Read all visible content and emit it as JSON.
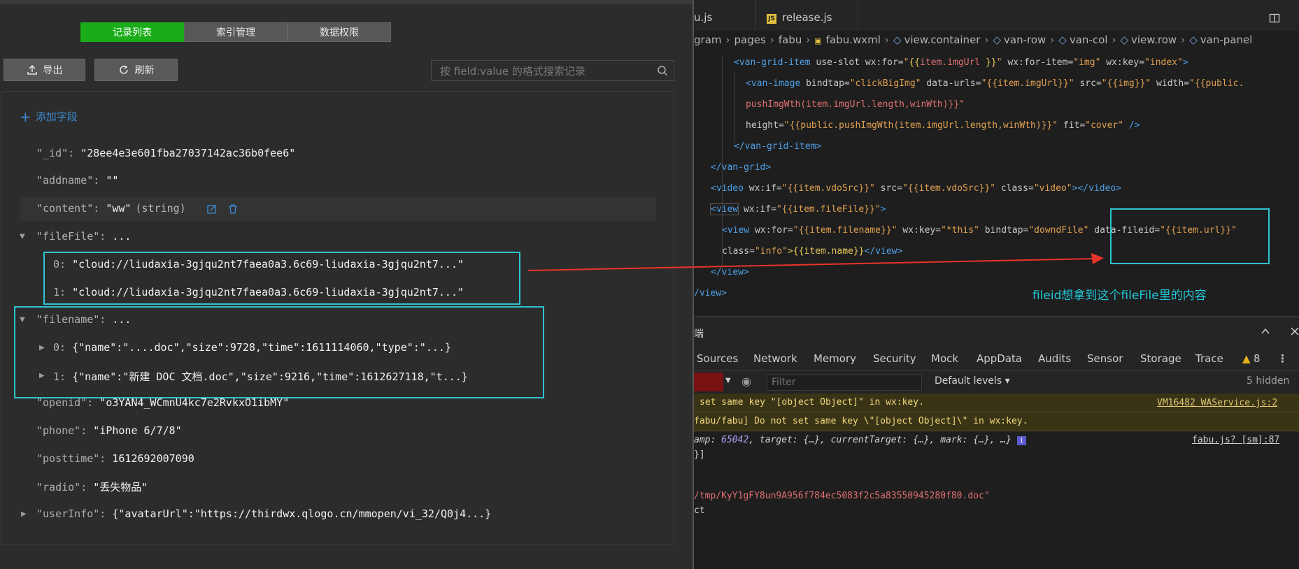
{
  "left": {
    "tabs": [
      "记录列表",
      "索引管理",
      "数据权限"
    ],
    "export_label": "导出",
    "refresh_label": "刷新",
    "search_placeholder": "按 field:value 的格式搜索记录",
    "add_field_label": "添加字段",
    "record": {
      "id_key": "\"_id\":",
      "id_val": "\"28ee4e3e601fba27037142ac36b0fee6\"",
      "addname_key": "\"addname\":",
      "addname_val": "\"\"",
      "content_key": "\"content\":",
      "content_val": "\"ww\"",
      "content_type": "(string)",
      "filefile_key": "\"fileFile\":",
      "filefile_val": "...",
      "filefile_items": [
        {
          "idx": "0:",
          "val": "\"cloud://liudaxia-3gjqu2nt7faea0a3.6c69-liudaxia-3gjqu2nt7...\""
        },
        {
          "idx": "1:",
          "val": "\"cloud://liudaxia-3gjqu2nt7faea0a3.6c69-liudaxia-3gjqu2nt7...\""
        }
      ],
      "filename_key": "\"filename\":",
      "filename_val": "...",
      "filename_items": [
        {
          "idx": "0:",
          "val": "{\"name\":\"....doc\",\"size\":9728,\"time\":1611114060,\"type\":\"...}"
        },
        {
          "idx": "1:",
          "val": "{\"name\":\"新建 DOC 文档.doc\",\"size\":9216,\"time\":1612627118,\"t...}"
        }
      ],
      "openid_key": "\"openid\":",
      "openid_val": "\"o3YAN4_WCmnU4kc7e2RvkxO1ibMY\"",
      "phone_key": "\"phone\":",
      "phone_val": "\"iPhone 6/7/8\"",
      "posttime_key": "\"posttime\":",
      "posttime_val": "1612692007090",
      "radio_key": "\"radio\":",
      "radio_val": "\"丢失物品\"",
      "userinfo_key": "\"userInfo\":",
      "userinfo_val": "{\"avatarUrl\":\"https://thirdwx.qlogo.cn/mmopen/vi_32/Q0j4...}"
    }
  },
  "right": {
    "file_tabs": [
      "u.js",
      "release.js"
    ],
    "file_tab_badge": "JS",
    "breadcrumbs": [
      "gram",
      "pages",
      "fabu",
      "fabu.wxml",
      "view.container",
      "van-row",
      "van-col",
      "view.row",
      "van-panel"
    ],
    "code": {
      "l1_a": "<van-grid-item",
      "l1_b": " use-slot wx:for=",
      "l1_c": "\"",
      "l1_d": "{{",
      "l1_e": "item.imgUrl ",
      "l1_f": "}}",
      "l1_g": "\"",
      "l1_h": " wx:for-item=",
      "l1_i": "\"img\"",
      "l1_j": " wx:key=",
      "l1_k": "\"index\"",
      "l1_l": ">",
      "l2_a": "<van-image",
      "l2_b": " bindtap=",
      "l2_c": "\"clickBigImg\"",
      "l2_d": " data-urls=",
      "l2_e": "\"{{item.imgUrl}}\"",
      "l2_f": " src=",
      "l2_g": "\"{{img}}\"",
      "l2_h": " width=",
      "l2_i": "\"{{public.",
      "l3": "pushImgWth(item.imgUrl.length,winWth)}}\"",
      "l4_a": "height=",
      "l4_b": "\"{{public.pushImgWth(item.imgUrl.length,winWth)}}\"",
      "l4_c": " fit=",
      "l4_d": "\"cover\"",
      "l4_e": " />",
      "l5": "</van-grid-item>",
      "l6": "</van-grid>",
      "l7_a": "<video",
      "l7_b": " wx:if=",
      "l7_c": "\"{{item.vdoSrc}}\"",
      "l7_d": " src=",
      "l7_e": "\"{{item.vdoSrc}}\"",
      "l7_f": " class=",
      "l7_g": "\"video\"",
      "l7_h": "></video>",
      "l8_a": "<view",
      "l8_b": "  wx:if=",
      "l8_c": "\"{{item.fileFile}}\"",
      "l8_d": ">",
      "l9_a": "<view",
      "l9_b": " wx:for=",
      "l9_c": "\"{{item.filename}}\"",
      "l9_d": " wx:key=",
      "l9_e": "\"*this\"",
      "l9_f": " bindtap=",
      "l9_g": "\"downdFile\"",
      "l9_h": " data-fileid=",
      "l9_i": "\"{{item.url}}\"",
      "l10_a": "class=",
      "l10_b": "\"info\"",
      "l10_c": ">{{item.name}}",
      "l10_d": "</view>",
      "l11": "</view>",
      "l12": "/view>"
    },
    "annotation": "fileid想拿到这个fileFile里的内容",
    "devtools": {
      "header_label": "端",
      "tabs": [
        "Sources",
        "Network",
        "Memory",
        "Security",
        "Mock",
        "AppData",
        "Audits",
        "Sensor",
        "Storage",
        "Trace"
      ],
      "warn_count": "8",
      "filter_placeholder": "Filter",
      "levels_label": "Default levels ▾",
      "hidden_label": "5 hidden",
      "warn1": "set same key \"[object Object]\" in wx:key.",
      "warn1_link": "VM16482 WAService.js:2",
      "warn2": "fabu/fabu] Do not set same key \\\"[object Object]\\\" in wx:key.",
      "log1_a": "amp: ",
      "log1_num": "65042",
      "log1_b": ", target: {…}, currentTarget: {…}, mark: {…}, …}",
      "log1_link": "fabu.js? [sm]:87",
      "log2": "}]",
      "log3": "/tmp/KyY1gFY8un9A956f784ec5083f2c5a83550945280f80.doc\"",
      "log4": "ct"
    }
  }
}
